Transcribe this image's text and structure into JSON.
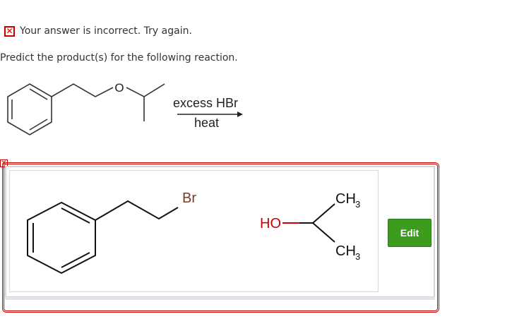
{
  "feedback": {
    "icon": "close-icon",
    "icon_glyph": "✕",
    "text": "Your answer is incorrect.  Try again.",
    "color": "#cc0000"
  },
  "question": {
    "prompt": "Predict the product(s) for the following reaction.",
    "reactant_oxygen": "O",
    "reagent": "excess HBr",
    "condition": "heat"
  },
  "answer": {
    "status_icon": "close-icon",
    "product1_halogen": "Br",
    "product2_hydroxyl": "HO",
    "methyl_main": "CH",
    "methyl_subscript": "3",
    "edit_label": "Edit",
    "edit_color": "#3d9b1e"
  }
}
